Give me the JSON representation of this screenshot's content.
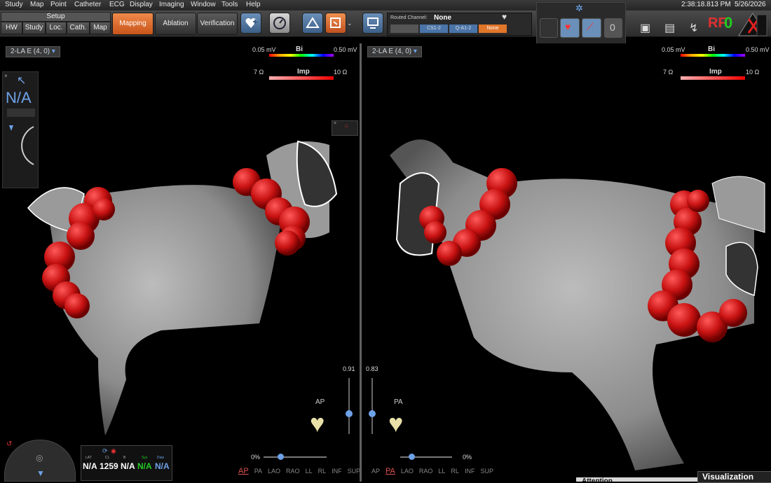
{
  "menu": [
    "Study",
    "Map",
    "Point",
    "Catheter",
    "ECG",
    "Display",
    "Imaging",
    "Window",
    "Tools",
    "Help"
  ],
  "setup": {
    "label": "Setup",
    "tabs": [
      "HW",
      "Study",
      "Loc.",
      "Cath.",
      "Map"
    ]
  },
  "workflow": {
    "mapping": "Mapping",
    "ablation": "Ablation",
    "verification": "Verification"
  },
  "routed": {
    "label": "Routed Channel:",
    "value": "None",
    "buttons": [
      "",
      "CS1-2",
      "Q-A1-2",
      "None"
    ]
  },
  "status": {
    "time": "2:38:18.813 PM",
    "date": "5/26/2026",
    "rf_label": "RF",
    "zero": "0"
  },
  "left_view": {
    "map_label": "2-LA E (4, 0)",
    "bi_min": "0.05 mV",
    "bi_name": "Bi",
    "bi_max": "0.50 mV",
    "imp_min": "7 Ω",
    "imp_name": "Imp",
    "imp_max": "10 Ω",
    "na_text": "N/A",
    "opacity": "0.91",
    "orient": "AP",
    "pct": "0%",
    "views": [
      "AP",
      "PA",
      "LAO",
      "RAO",
      "LL",
      "RL",
      "INF",
      "SUP"
    ],
    "selected_view": "AP"
  },
  "right_view": {
    "map_label": "2-LA E (4, 0)",
    "bi_min": "0.05 mV",
    "bi_name": "Bi",
    "bi_max": "0.50 mV",
    "imp_min": "7 Ω",
    "imp_name": "Imp",
    "imp_max": "10 Ω",
    "opacity": "0.83",
    "orient": "PA",
    "pct": "0%",
    "views": [
      "AP",
      "PA",
      "LAO",
      "RAO",
      "LL",
      "RL",
      "INF",
      "SUP"
    ],
    "selected_view": "PA"
  },
  "info": {
    "lat_h": "LAT",
    "cl_h": "CL",
    "b_h": "B",
    "sys_h": "Sys",
    "dia_h": "Dias",
    "lat": "N/A",
    "cl": "1259",
    "b": "N/A",
    "sys": "N/A",
    "dia": "N/A"
  },
  "bottom": {
    "attention": "Attention",
    "visualization": "Visualization"
  },
  "colors": {
    "accent": "#e0662a",
    "ablation_red": "#c81212",
    "tissue": "#a9a9a9"
  }
}
